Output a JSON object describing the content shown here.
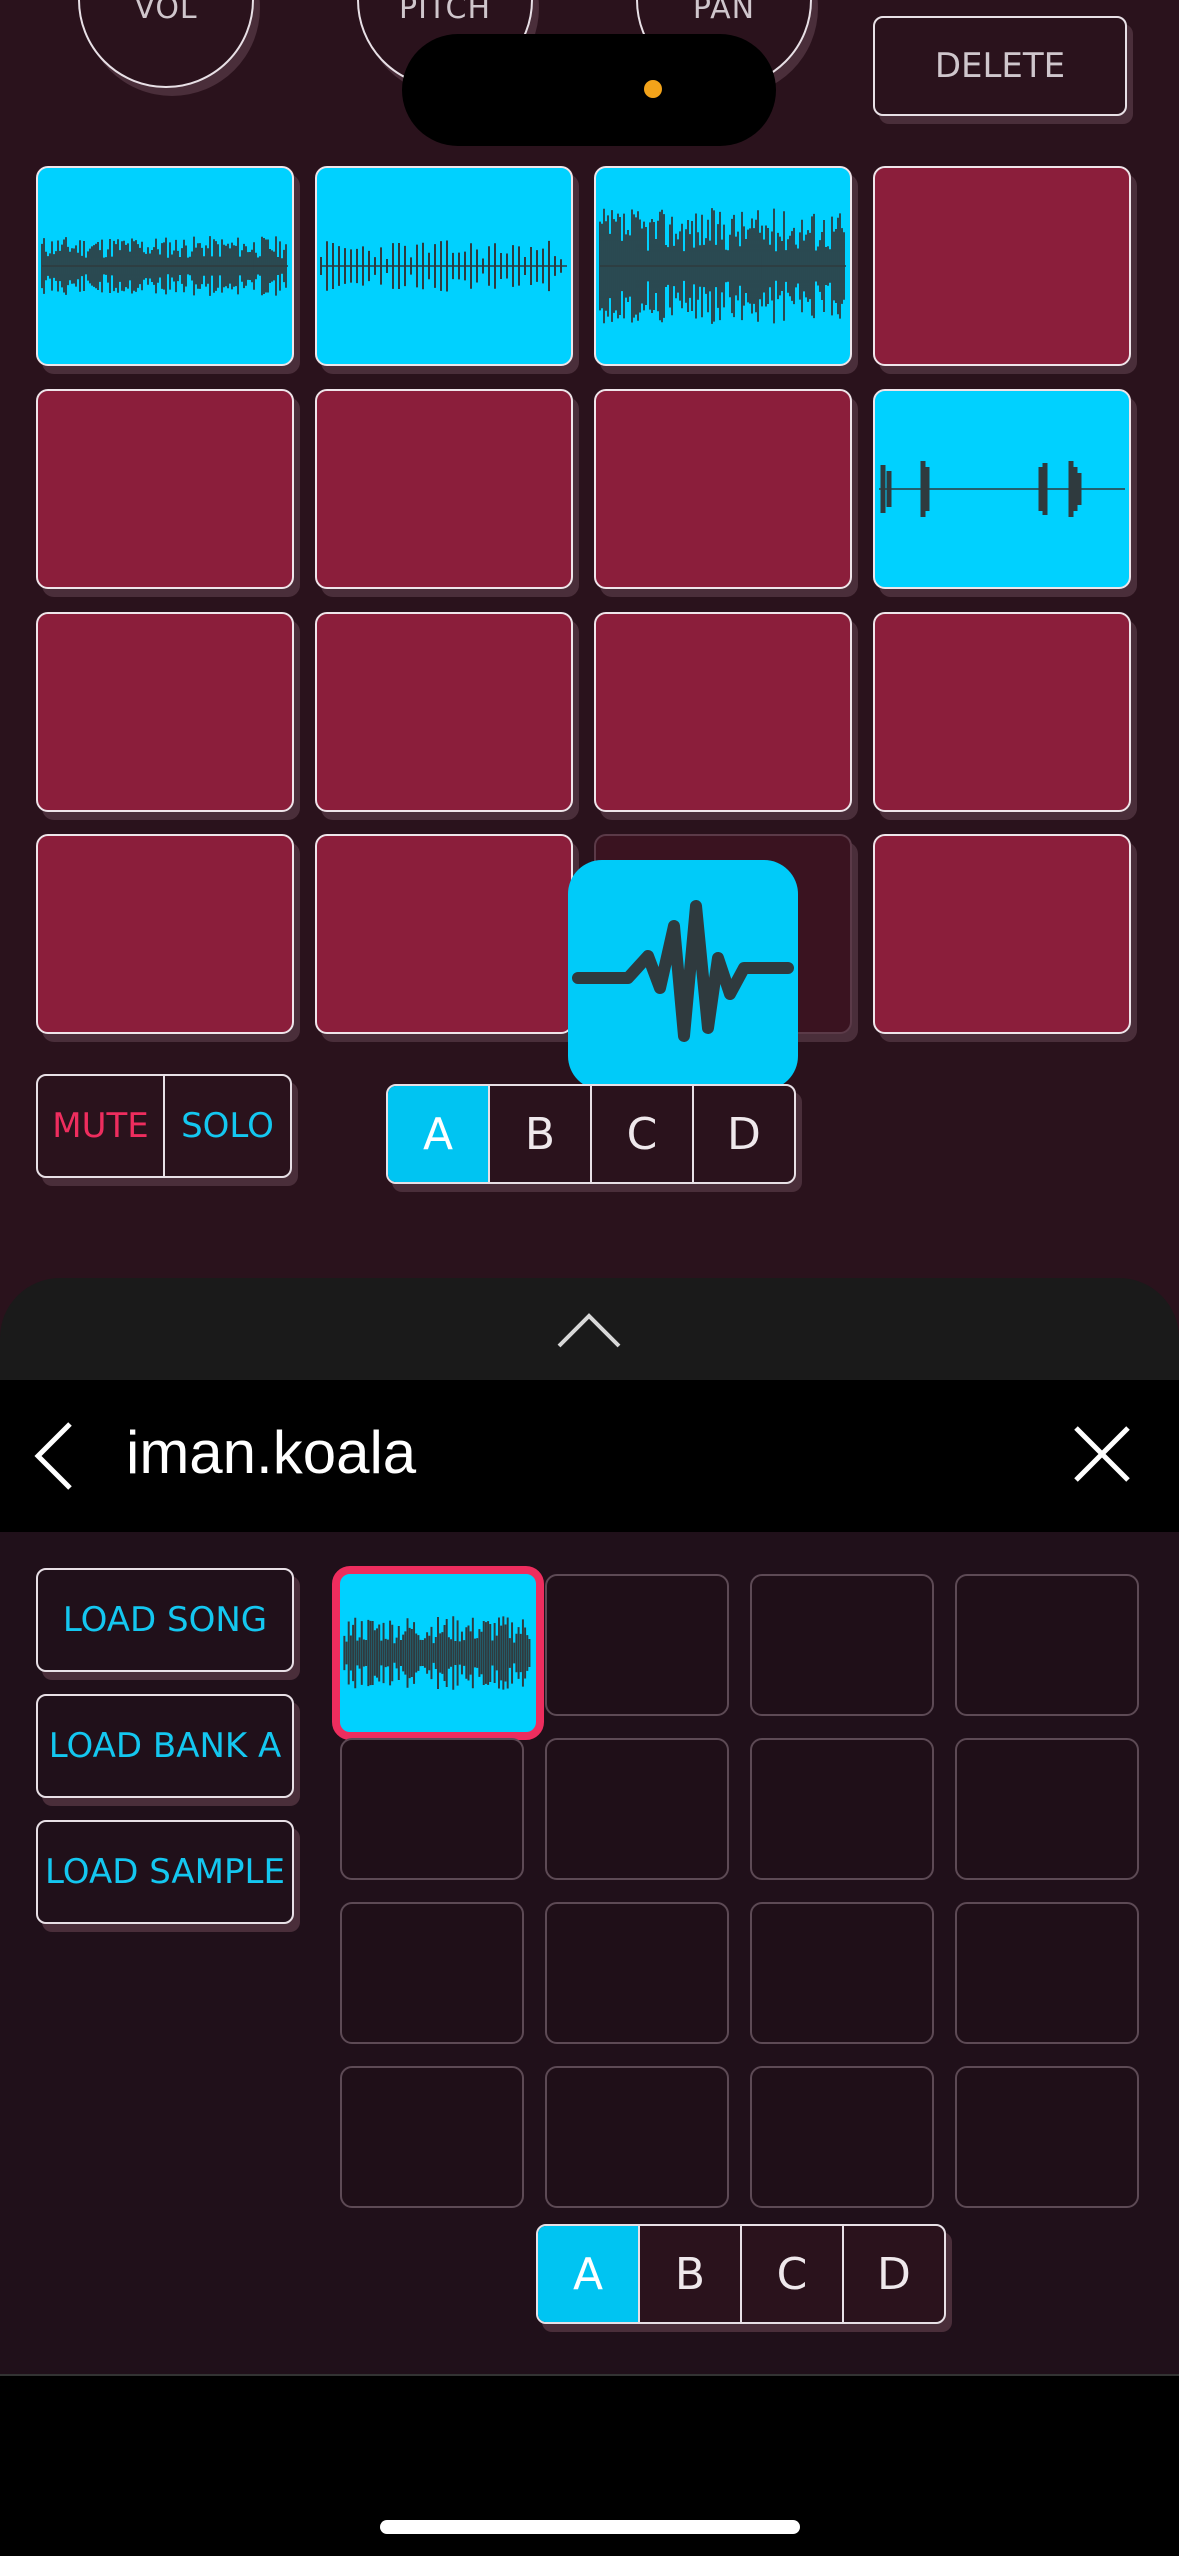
{
  "knobs": [
    "VOL",
    "PITCH",
    "PAN"
  ],
  "delete_label": "DELETE",
  "pads": [
    "loaded",
    "loaded",
    "loaded",
    "empty",
    "empty",
    "empty",
    "empty",
    "loaded",
    "empty",
    "empty",
    "empty",
    "empty",
    "empty",
    "empty",
    "dim",
    "empty"
  ],
  "mute_label": "MUTE",
  "solo_label": "SOLO",
  "banks": [
    "A",
    "B",
    "C",
    "D"
  ],
  "active_bank": "A",
  "sheet": {
    "title": "iman.koala",
    "load_song": "LOAD SONG",
    "load_bank": "LOAD BANK A",
    "load_sample": "LOAD SAMPLE",
    "banks": [
      "A",
      "B",
      "C",
      "D"
    ],
    "active_bank": "A"
  },
  "colors": {
    "pad_empty": "#8b1e3b",
    "pad_loaded": "#00d1ff",
    "accent_pink": "#ee2d5e",
    "accent_cyan": "#14c7f0",
    "background": "#2a121c"
  },
  "icons": {
    "floating": "waveform-icon",
    "sheet_handle": "chevron-up-icon",
    "back": "chevron-left-icon",
    "close": "close-icon"
  }
}
